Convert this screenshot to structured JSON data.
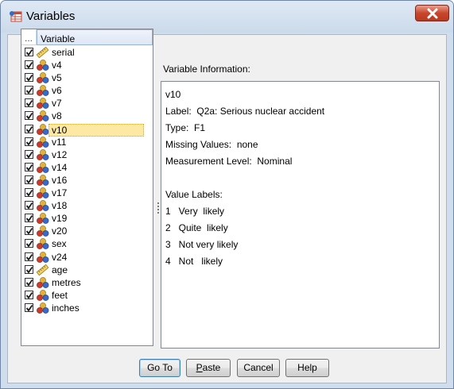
{
  "window": {
    "title": "Variables"
  },
  "variable_list": {
    "header_dots": "...",
    "header_label": "Variable",
    "items": [
      {
        "label": "serial",
        "icon": "ruler-icon",
        "checked": true
      },
      {
        "label": "v4",
        "icon": "nominal-icon",
        "checked": true
      },
      {
        "label": "v5",
        "icon": "nominal-icon",
        "checked": true
      },
      {
        "label": "v6",
        "icon": "nominal-icon",
        "checked": true
      },
      {
        "label": "v7",
        "icon": "nominal-icon",
        "checked": true
      },
      {
        "label": "v8",
        "icon": "nominal-icon",
        "checked": true
      },
      {
        "label": "v10",
        "icon": "nominal-icon",
        "checked": true,
        "selected": true
      },
      {
        "label": "v11",
        "icon": "nominal-icon",
        "checked": true
      },
      {
        "label": "v12",
        "icon": "nominal-icon",
        "checked": true
      },
      {
        "label": "v14",
        "icon": "nominal-icon",
        "checked": true
      },
      {
        "label": "v16",
        "icon": "nominal-icon",
        "checked": true
      },
      {
        "label": "v17",
        "icon": "nominal-icon",
        "checked": true
      },
      {
        "label": "v18",
        "icon": "nominal-icon",
        "checked": true
      },
      {
        "label": "v19",
        "icon": "nominal-icon",
        "checked": true
      },
      {
        "label": "v20",
        "icon": "nominal-icon",
        "checked": true
      },
      {
        "label": "sex",
        "icon": "nominal-icon",
        "checked": true
      },
      {
        "label": "v24",
        "icon": "nominal-icon",
        "checked": true
      },
      {
        "label": "age",
        "icon": "ruler-icon",
        "checked": true
      },
      {
        "label": "metres",
        "icon": "nominal-icon",
        "checked": true
      },
      {
        "label": "feet",
        "icon": "nominal-icon",
        "checked": true
      },
      {
        "label": "inches",
        "icon": "nominal-icon",
        "checked": true
      }
    ]
  },
  "info": {
    "title": "Variable Information:",
    "lines": [
      "v10",
      "Label:  Q2a: Serious nuclear accident",
      "Type:  F1",
      "Missing Values:  none",
      "Measurement Level:  Nominal",
      "",
      "Value Labels:",
      "1   Very  likely",
      "2   Quite  likely",
      "3   Not very likely",
      "4   Not   likely"
    ]
  },
  "buttons": {
    "goto": "Go To",
    "paste": "Paste",
    "cancel": "Cancel",
    "help": "Help"
  },
  "colors": {
    "selection": "#fde9a3",
    "close_button": "#c9462c",
    "title_bar": "#cbdaea"
  }
}
